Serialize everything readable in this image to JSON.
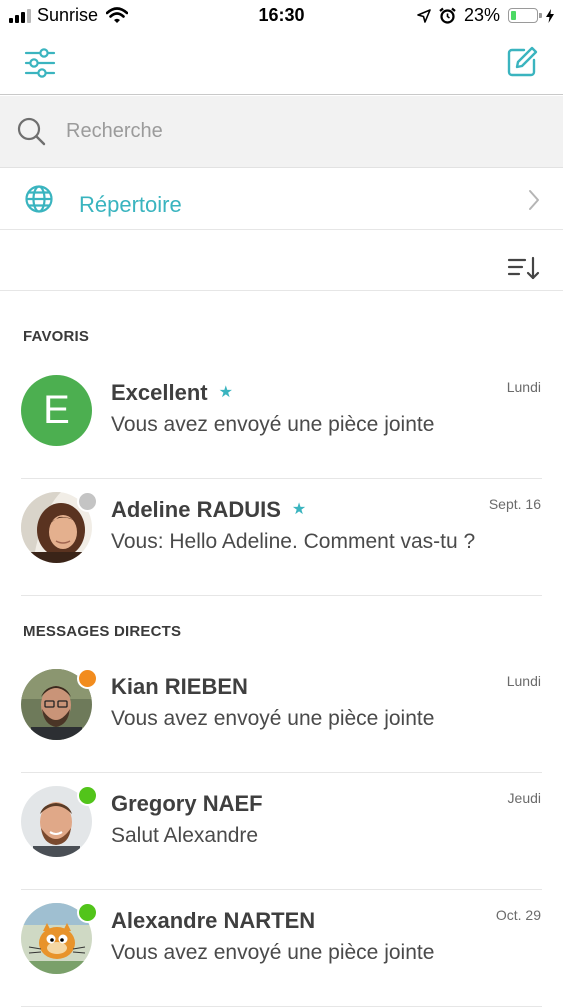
{
  "status_bar": {
    "carrier": "Sunrise",
    "time": "16:30",
    "battery_percent": "23%",
    "battery_level": 0.23,
    "icons": [
      "signal-icon",
      "wifi-icon",
      "location-arrow-icon",
      "alarm-icon",
      "battery-icon",
      "charging-bolt-icon"
    ]
  },
  "nav": {
    "left_icon": "filter-sliders-icon",
    "right_icon": "compose-icon",
    "accent_color": "#3ab4bf"
  },
  "search": {
    "placeholder": "Recherche",
    "value": ""
  },
  "directory": {
    "label": "Répertoire",
    "icon": "globe-icon"
  },
  "sort": {
    "icon": "sort-icon"
  },
  "sections": {
    "favorites": {
      "title": "FAVORIS",
      "items": [
        {
          "name": "Excellent",
          "favorite": true,
          "preview": "Vous avez envoyé une pièce jointe",
          "date": "Lundi",
          "avatar_letter": "E",
          "avatar_color": "#4caf50"
        },
        {
          "name": "Adeline RADUIS",
          "favorite": true,
          "preview": "Vous: Hello Adeline. Comment vas-tu ?",
          "date": "Sept. 16",
          "presence_color": "#c4c4c4"
        }
      ]
    },
    "direct": {
      "title": "MESSAGES DIRECTS",
      "items": [
        {
          "name": "Kian RIEBEN",
          "preview": "Vous avez envoyé une pièce jointe",
          "date": "Lundi",
          "presence_color": "#f28c1e"
        },
        {
          "name": "Gregory NAEF",
          "preview": "Salut Alexandre",
          "date": "Jeudi",
          "presence_color": "#52c41a"
        },
        {
          "name": "Alexandre NARTEN",
          "preview": "Vous avez envoyé une pièce jointe",
          "date": "Oct. 29",
          "presence_color": "#52c41a"
        }
      ]
    }
  }
}
